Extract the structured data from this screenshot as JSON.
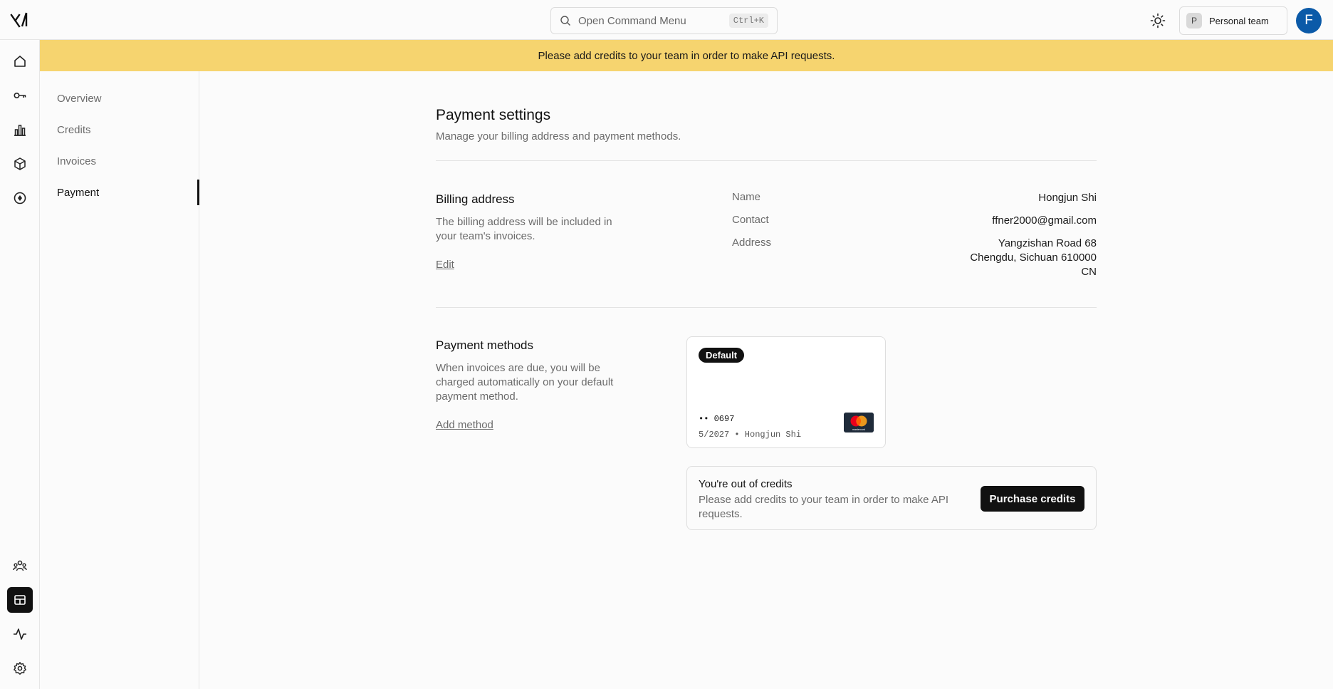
{
  "header": {
    "command_placeholder": "Open Command Menu",
    "command_shortcut": "Ctrl+K",
    "team_initial": "P",
    "team_label": "Personal team",
    "user_initial": "F"
  },
  "rail": {
    "icons": [
      "home-icon",
      "key-icon",
      "bar-chart-icon",
      "cube-icon",
      "compass-icon",
      "team-icon",
      "billing-icon",
      "activity-icon",
      "settings-icon"
    ],
    "active": "billing-icon"
  },
  "banner": {
    "text": "Please add credits to your team in order to make API requests."
  },
  "subnav": {
    "items": [
      {
        "label": "Overview"
      },
      {
        "label": "Credits"
      },
      {
        "label": "Invoices"
      },
      {
        "label": "Payment"
      }
    ],
    "active": "Payment"
  },
  "page": {
    "title": "Payment settings",
    "subtitle": "Manage your billing address and payment methods."
  },
  "billing": {
    "title": "Billing address",
    "description": "The billing address will be included in your team's invoices.",
    "edit_label": "Edit",
    "name_label": "Name",
    "name_value": "Hongjun Shi",
    "contact_label": "Contact",
    "contact_value": "ffner2000@gmail.com",
    "address_label": "Address",
    "address_line1": "Yangzishan Road 68",
    "address_line2": "Chengdu, Sichuan 610000",
    "address_line3": "CN"
  },
  "payment": {
    "title": "Payment methods",
    "description": "When invoices are due, you will be charged automatically on your default payment method.",
    "add_label": "Add method",
    "card": {
      "badge": "Default",
      "number": "•• 0697",
      "meta": "5/2027 • Hongjun Shi",
      "brand": "mastercard-icon",
      "brand_text": "mastercard"
    }
  },
  "alert": {
    "title": "You're out of credits",
    "description": "Please add credits to your team in order to make API requests.",
    "button": "Purchase credits"
  },
  "colors": {
    "banner": "#f6d46f",
    "accent": "#111111",
    "avatar": "#0b5aa8"
  }
}
